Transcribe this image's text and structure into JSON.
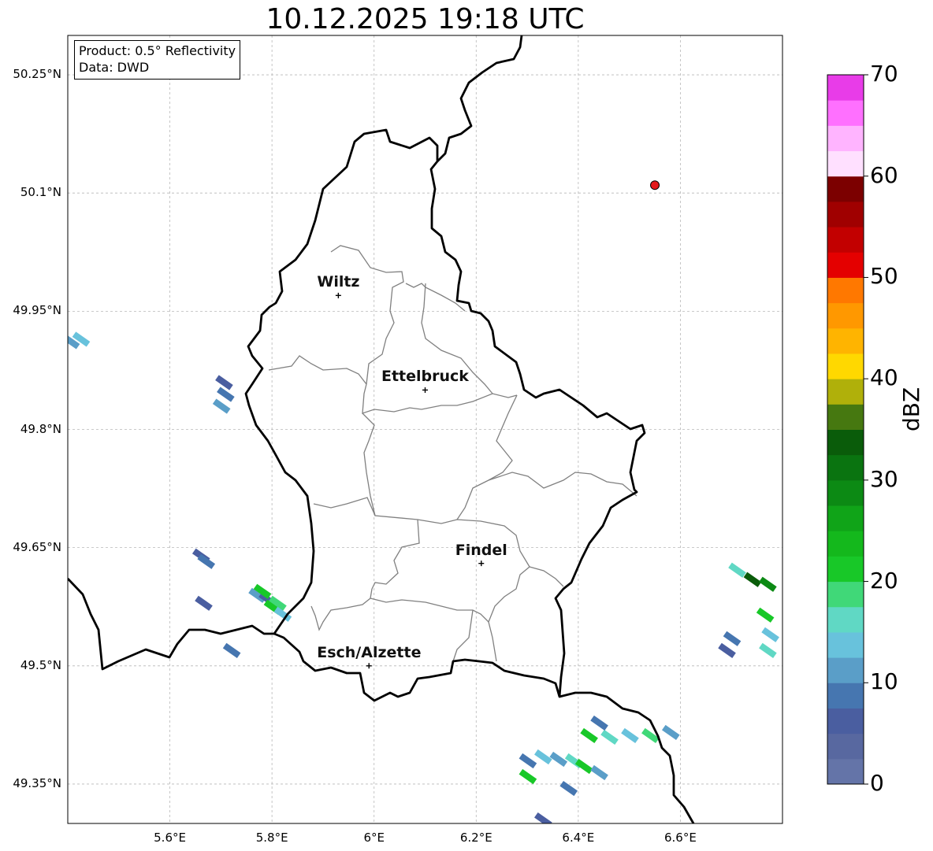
{
  "title": "10.12.2025 19:18 UTC",
  "info": {
    "product": "Product: 0.5° Reflectivity",
    "data": "Data: DWD"
  },
  "map_extent": {
    "lon": [
      5.4,
      6.8
    ],
    "lat": [
      49.3,
      50.3
    ]
  },
  "lat_ticks": [
    {
      "value": 50.25,
      "label": "50.25°N"
    },
    {
      "value": 50.1,
      "label": "50.1°N"
    },
    {
      "value": 49.95,
      "label": "49.95°N"
    },
    {
      "value": 49.8,
      "label": "49.8°N"
    },
    {
      "value": 49.65,
      "label": "49.65°N"
    },
    {
      "value": 49.5,
      "label": "49.5°N"
    },
    {
      "value": 49.35,
      "label": "49.35°N"
    }
  ],
  "lon_ticks": [
    {
      "value": 5.6,
      "label": "5.6°E"
    },
    {
      "value": 5.8,
      "label": "5.8°E"
    },
    {
      "value": 6.0,
      "label": "6°E"
    },
    {
      "value": 6.2,
      "label": "6.2°E"
    },
    {
      "value": 6.4,
      "label": "6.4°E"
    },
    {
      "value": 6.6,
      "label": "6.6°E"
    }
  ],
  "cities": [
    {
      "name": "Wiltz",
      "lon": 5.93,
      "lat": 49.97
    },
    {
      "name": "Ettelbruck",
      "lon": 6.1,
      "lat": 49.85
    },
    {
      "name": "Findel",
      "lon": 6.21,
      "lat": 49.63
    },
    {
      "name": "Esch/Alzette",
      "lon": 5.99,
      "lat": 49.5
    }
  ],
  "radar_site": {
    "lon": 6.55,
    "lat": 50.11,
    "color": "#e41a1c"
  },
  "colorbar": {
    "unit": "dBZ",
    "min": 0,
    "max": 70,
    "step": 2.5,
    "ticks": [
      0,
      10,
      20,
      30,
      40,
      50,
      60,
      70
    ],
    "colors": [
      "#6474a8",
      "#5868a0",
      "#4a5ea0",
      "#4676b0",
      "#5a9ec8",
      "#68c2dc",
      "#60d8c4",
      "#40d878",
      "#18c828",
      "#14b81c",
      "#10a418",
      "#0c8a14",
      "#0a7410",
      "#0a5c0a",
      "#467810",
      "#b0b00a",
      "#ffd800",
      "#ffb400",
      "#ff9800",
      "#ff7800",
      "#e40000",
      "#c20000",
      "#a00000",
      "#7c0000",
      "#ffe0ff",
      "#ffb4ff",
      "#ff70ff",
      "#e83ce8"
    ]
  },
  "radar_echoes": [
    {
      "lon": 5.405,
      "lat": 49.912,
      "dbz": 12
    },
    {
      "lon": 5.425,
      "lat": 49.915,
      "dbz": 14
    },
    {
      "lon": 5.705,
      "lat": 49.86,
      "dbz": 6
    },
    {
      "lon": 5.708,
      "lat": 49.845,
      "dbz": 8
    },
    {
      "lon": 5.7,
      "lat": 49.83,
      "dbz": 12
    },
    {
      "lon": 5.66,
      "lat": 49.64,
      "dbz": 6
    },
    {
      "lon": 5.67,
      "lat": 49.633,
      "dbz": 8
    },
    {
      "lon": 5.665,
      "lat": 49.58,
      "dbz": 6
    },
    {
      "lon": 5.72,
      "lat": 49.52,
      "dbz": 8
    },
    {
      "lon": 5.77,
      "lat": 49.59,
      "dbz": 10
    },
    {
      "lon": 5.79,
      "lat": 49.585,
      "dbz": 6
    },
    {
      "lon": 5.8,
      "lat": 49.575,
      "dbz": 22
    },
    {
      "lon": 5.81,
      "lat": 49.58,
      "dbz": 18
    },
    {
      "lon": 5.82,
      "lat": 49.566,
      "dbz": 14
    },
    {
      "lon": 5.78,
      "lat": 49.595,
      "dbz": 20
    },
    {
      "lon": 6.71,
      "lat": 49.622,
      "dbz": 16
    },
    {
      "lon": 6.74,
      "lat": 49.61,
      "dbz": 34
    },
    {
      "lon": 6.77,
      "lat": 49.604,
      "dbz": 28
    },
    {
      "lon": 6.765,
      "lat": 49.565,
      "dbz": 22
    },
    {
      "lon": 6.775,
      "lat": 49.54,
      "dbz": 14
    },
    {
      "lon": 6.77,
      "lat": 49.52,
      "dbz": 16
    },
    {
      "lon": 6.7,
      "lat": 49.535,
      "dbz": 8
    },
    {
      "lon": 6.69,
      "lat": 49.52,
      "dbz": 6
    },
    {
      "lon": 6.42,
      "lat": 49.412,
      "dbz": 20
    },
    {
      "lon": 6.46,
      "lat": 49.41,
      "dbz": 16
    },
    {
      "lon": 6.5,
      "lat": 49.412,
      "dbz": 14
    },
    {
      "lon": 6.54,
      "lat": 49.412,
      "dbz": 18
    },
    {
      "lon": 6.58,
      "lat": 49.416,
      "dbz": 12
    },
    {
      "lon": 6.44,
      "lat": 49.428,
      "dbz": 8
    },
    {
      "lon": 6.3,
      "lat": 49.38,
      "dbz": 8
    },
    {
      "lon": 6.33,
      "lat": 49.385,
      "dbz": 14
    },
    {
      "lon": 6.36,
      "lat": 49.382,
      "dbz": 12
    },
    {
      "lon": 6.39,
      "lat": 49.38,
      "dbz": 16
    },
    {
      "lon": 6.41,
      "lat": 49.373,
      "dbz": 22
    },
    {
      "lon": 6.44,
      "lat": 49.365,
      "dbz": 10
    },
    {
      "lon": 6.3,
      "lat": 49.36,
      "dbz": 20
    },
    {
      "lon": 6.38,
      "lat": 49.345,
      "dbz": 8
    },
    {
      "lon": 6.33,
      "lat": 49.305,
      "dbz": 6
    }
  ]
}
